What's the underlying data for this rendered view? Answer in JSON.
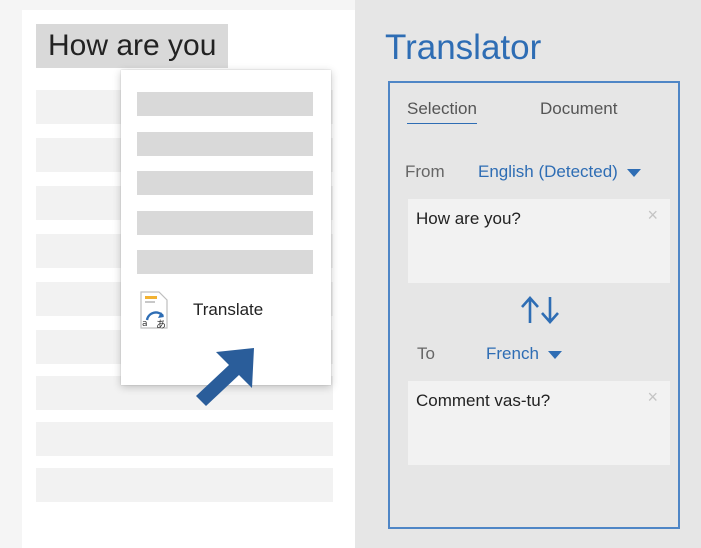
{
  "document": {
    "heading": "How are you"
  },
  "context_menu": {
    "translate_label": "Translate",
    "translate_icon": "translate-icon"
  },
  "translator": {
    "title": "Translator",
    "tabs": [
      {
        "label": "Selection",
        "active": true
      },
      {
        "label": "Document",
        "active": false
      }
    ],
    "from_label": "From",
    "from_language": "English (Detected)",
    "source_text": "How are you?",
    "to_label": "To",
    "to_language": "French",
    "target_text": "Comment vas-tu?",
    "clear_symbol": "×",
    "accent_color": "#2e6db4"
  }
}
